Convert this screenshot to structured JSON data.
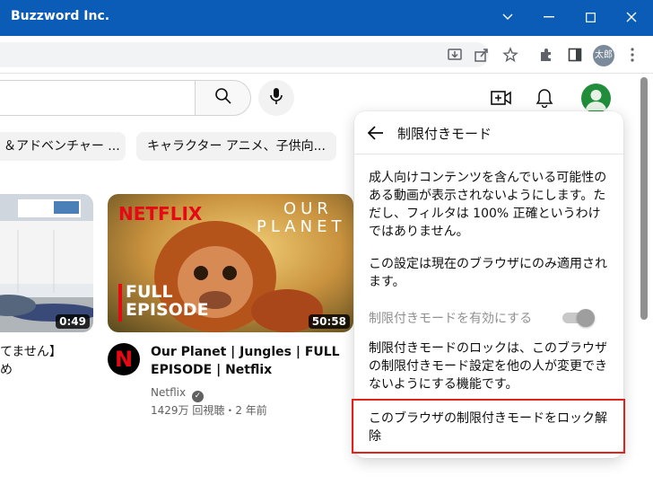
{
  "window": {
    "title": "Buzzword Inc."
  },
  "browser": {
    "profile_label": "太郎"
  },
  "chips": [
    {
      "label": "＆アドベンチャー ..."
    },
    {
      "label": "キャラクター アニメ、子供向..."
    }
  ],
  "videos": [
    {
      "title_line1": "てません】",
      "title_line2": "め",
      "duration": "0:49"
    },
    {
      "thumbnail_brand": "NETFLIX",
      "thumbnail_show_line1": "OUR",
      "thumbnail_show_line2": "PLANET",
      "thumbnail_badge_line1": "FULL",
      "thumbnail_badge_line2": "EPISODE",
      "duration": "50:58",
      "title_line1": "Our Planet | Jungles | FULL",
      "title_line2": "EPISODE | Netflix",
      "channel": "Netflix",
      "channel_avatar_letter": "N",
      "stats": "1429万 回視聴・2 年前"
    }
  ],
  "restricted_panel": {
    "title": "制限付きモード",
    "description_1": "成人向けコンテンツを含んでいる可能性のある動画が表示されないようにします。ただし、フィルタは 100% 正確というわけではありません。",
    "description_2": "この設定は現在のブラウザにのみ適用されます。",
    "toggle_label": "制限付きモードを有効にする",
    "toggle_on": true,
    "lock_description": "制限付きモードのロックは、このブラウザの制限付きモード設定を他の人が変更できないようにする機能です。",
    "unlock_link": "このブラウザの制限付きモードをロック解除"
  },
  "colors": {
    "titlebar": "#0b5cb6",
    "highlight_border": "#e0231c",
    "netflix_red": "#e50914"
  }
}
